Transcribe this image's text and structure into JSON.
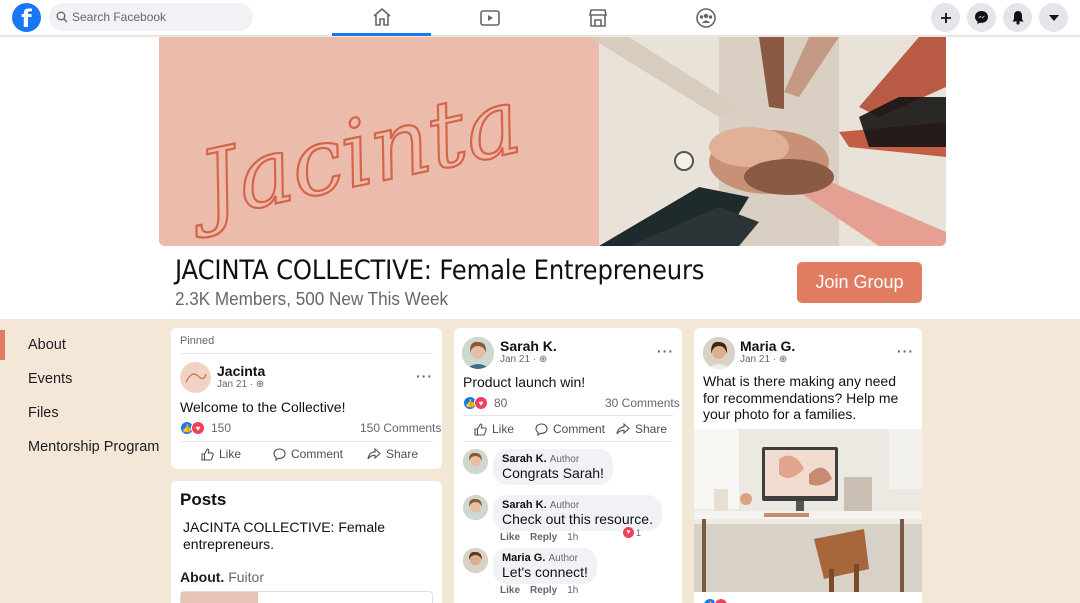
{
  "search": {
    "placeholder": "Search Facebook"
  },
  "group": {
    "title": "JACINTA COLLECTIVE: Female Entrepreneurs",
    "subtitle": "2.3K Members, 500 New This Week",
    "join": "Join Group",
    "cover_script": "Jacinta"
  },
  "sidebar": {
    "items": [
      {
        "label": "About"
      },
      {
        "label": "Events"
      },
      {
        "label": "Files"
      },
      {
        "label": "Mentorship Program"
      }
    ]
  },
  "pinned": {
    "header": "Pinned",
    "author": "Jacinta",
    "date": "Jan 21 · ",
    "text": "Welcome to the Collective!",
    "reactions": "150",
    "comments": "150 Comments",
    "like": "Like",
    "comment": "Comment",
    "share": "Share"
  },
  "posts_card": {
    "title": "Posts",
    "text": "JACINTA COLLECTIVE: Female entrepreneurs.",
    "about_label": "About.",
    "about_value": "Fuitor"
  },
  "post2": {
    "author": "Sarah K.",
    "date": "Jan 21 · ",
    "text": "Product launch win!",
    "reactions": "80",
    "comments": "30 Comments",
    "like": "Like",
    "comment": "Comment",
    "share": "Share",
    "replies": [
      {
        "name": "Sarah K.",
        "role": "Author",
        "text": "Congrats Sarah!"
      },
      {
        "name": "Sarah K.",
        "role": "Author",
        "text": "Check out this resource.",
        "like": "Like",
        "reply": "Reply",
        "time": "1h",
        "heart_count": "1"
      },
      {
        "name": "Maria G.",
        "role": "Author",
        "text": "Let's connect!",
        "like": "Like",
        "reply": "Reply",
        "time": "1h"
      }
    ]
  },
  "post3": {
    "author": "Maria G.",
    "date": "Jan 21 · ",
    "text": "What is there making any need for recommendations? Help me your photo for a families."
  },
  "colors": {
    "accent": "#e17b62",
    "fb_blue": "#1877f2",
    "page_bg": "#f4e7d8"
  },
  "icons": [
    "facebook-logo",
    "search-icon",
    "home-icon",
    "video-icon",
    "marketplace-icon",
    "groups-icon",
    "plus-icon",
    "messenger-icon",
    "bell-icon",
    "caret-down-icon",
    "globe-icon",
    "more-icon",
    "like-icon",
    "comment-icon",
    "share-icon",
    "heart-icon"
  ]
}
